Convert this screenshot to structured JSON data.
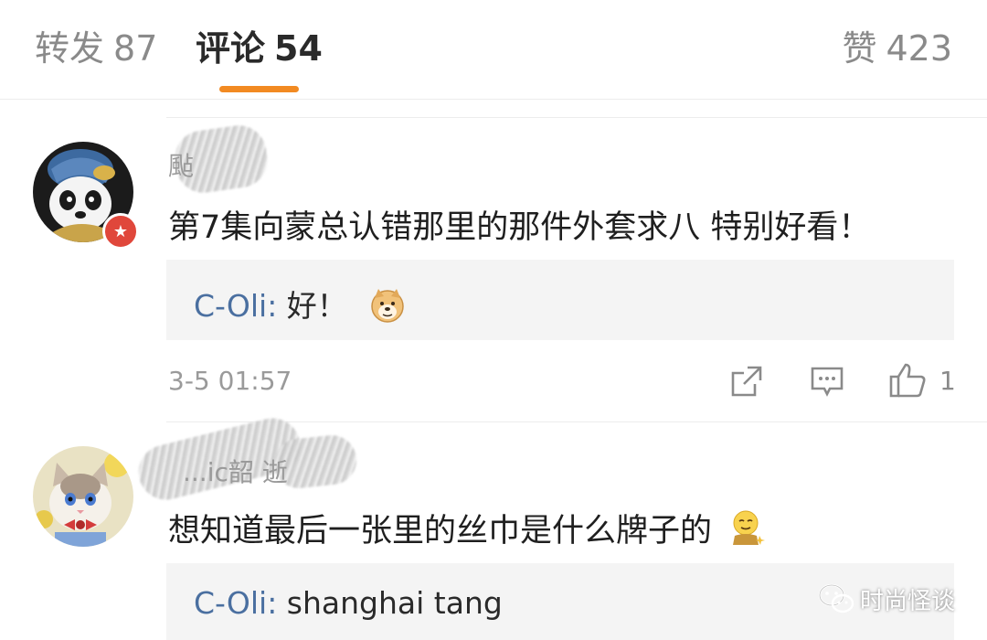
{
  "tabs": [
    {
      "label": "转发",
      "count": "87"
    },
    {
      "label": "评论",
      "count": "54"
    }
  ],
  "likes_tab": {
    "label": "赞",
    "count": "423"
  },
  "comments": [
    {
      "username": "颭",
      "text": "第7集向蒙总认错那里的那件外套求八 特别好看！",
      "reply": {
        "author": "C-Oli",
        "separator": ": ",
        "content": "好！",
        "emoji": "doge-emoji"
      },
      "time": "3-5 01:57",
      "like_count": "1"
    },
    {
      "username": "...ic韶 逝",
      "text": "想知道最后一张里的丝巾是什么牌子的",
      "text_emoji": "thinking-emoji",
      "reply": {
        "author": "C-Oli",
        "separator": ": ",
        "content": "shanghai tang"
      }
    }
  ],
  "watermark": {
    "text": "时尚怪谈"
  },
  "colors": {
    "accent": "#f28a22",
    "link": "#4a6fa0",
    "badge": "#e0473b"
  }
}
